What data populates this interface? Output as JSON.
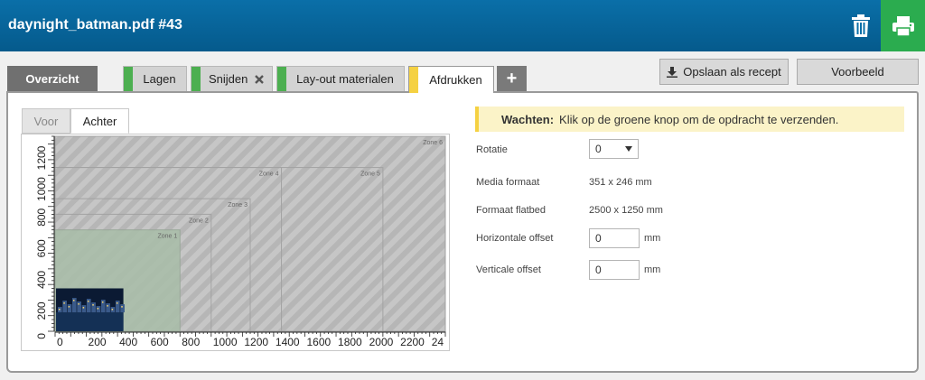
{
  "header": {
    "title": "daynight_batman.pdf #43"
  },
  "tabs": [
    {
      "id": "overzicht",
      "label": "Overzicht",
      "strip": ""
    },
    {
      "id": "lagen",
      "label": "Lagen",
      "strip": "#4caf50"
    },
    {
      "id": "snijden",
      "label": "Snijden",
      "strip": "#4caf50"
    },
    {
      "id": "layout",
      "label": "Lay-out materialen",
      "strip": "#4caf50"
    },
    {
      "id": "afdrukken",
      "label": "Afdrukken",
      "strip": "#f5d142"
    }
  ],
  "add_tab_symbol": "+",
  "actions": {
    "save_recipe": "Opslaan als recept",
    "preview": "Voorbeeld"
  },
  "side_tabs": {
    "front": "Voor",
    "back": "Achter"
  },
  "notice": {
    "strong": "Wachten:",
    "text": "Klik op de groene knop om de opdracht te verzenden."
  },
  "form": {
    "rotation_label": "Rotatie",
    "rotation_value": "0",
    "media_format_label": "Media formaat",
    "media_format_value": "351 x 246 mm",
    "flatbed_label": "Formaat flatbed",
    "flatbed_value": "2500 x 1250 mm",
    "h_offset_label": "Horizontale offset",
    "h_offset_value": "0",
    "h_offset_unit": "mm",
    "v_offset_label": "Verticale offset",
    "v_offset_value": "0",
    "v_offset_unit": "mm"
  },
  "flatbed": {
    "x_ticks": [
      "0",
      "200",
      "400",
      "600",
      "800",
      "1000",
      "1200",
      "1400",
      "1600",
      "1800",
      "2000",
      "2200",
      "24"
    ],
    "y_ticks": [
      "0",
      "200",
      "400",
      "600",
      "800",
      "1000",
      "1200"
    ],
    "zones": [
      {
        "label": "Zone 1",
        "w": 800,
        "h": 650
      },
      {
        "label": "Zone 2",
        "w": 1000,
        "h": 750
      },
      {
        "label": "Zone 3",
        "w": 1250,
        "h": 850
      },
      {
        "label": "Zone 4",
        "w": 1450,
        "h": 1050
      },
      {
        "label": "Zone 5",
        "w": 2100,
        "h": 1050
      },
      {
        "label": "Zone 6",
        "w": 2500,
        "h": 1250
      }
    ],
    "media": {
      "w": 351,
      "h": 246
    }
  },
  "colors": {
    "header": "#0a6fa8",
    "print": "#2bac4f",
    "done_strip": "#4caf50",
    "active_strip": "#f5d142"
  }
}
